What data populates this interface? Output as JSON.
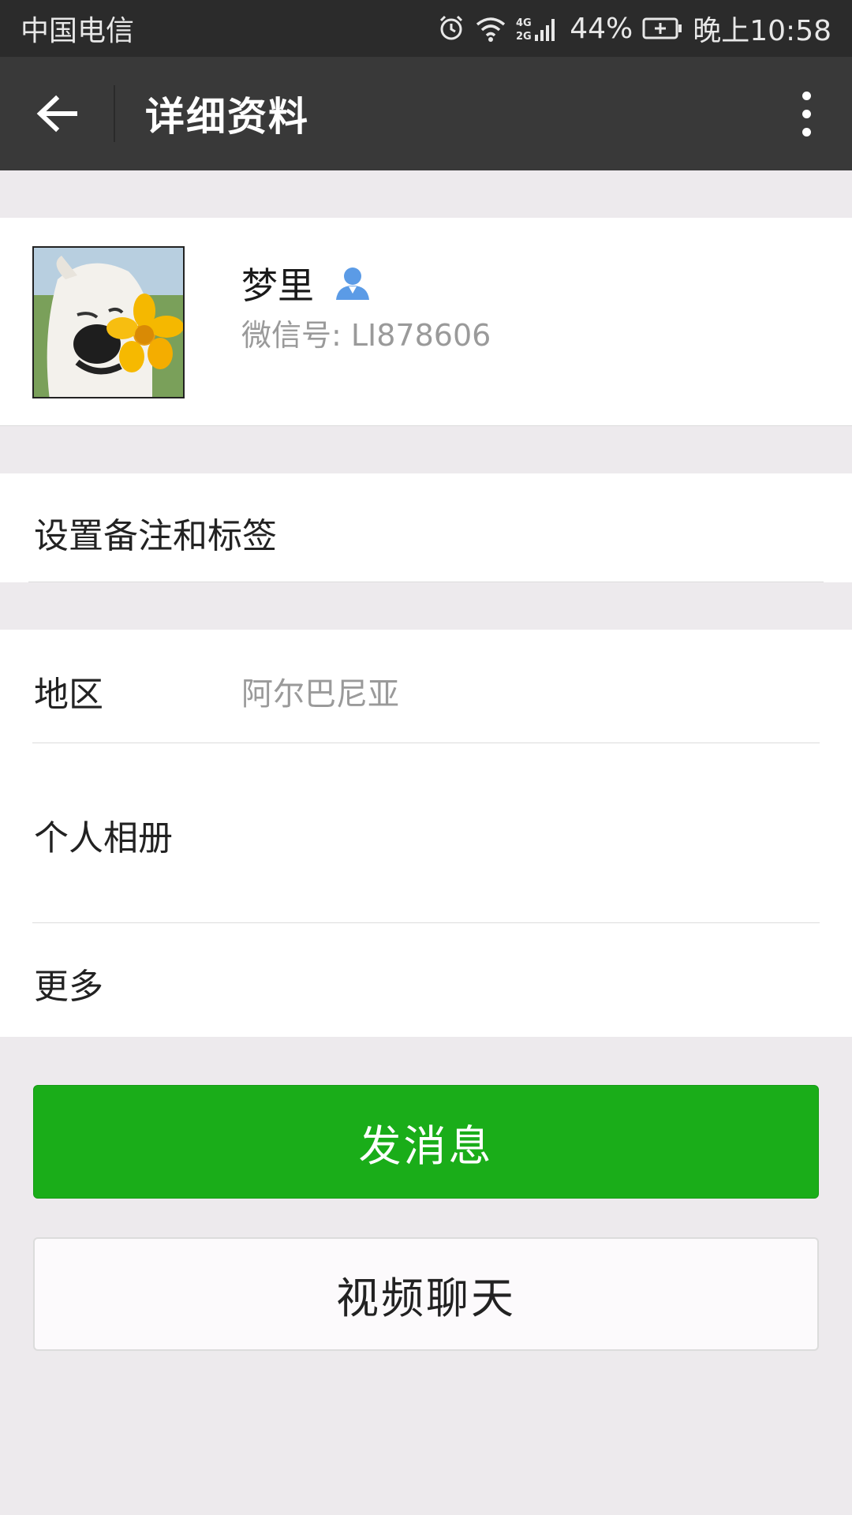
{
  "status_bar": {
    "carrier": "中国电信",
    "network": "4G 2G",
    "battery": "44%",
    "time": "晚上10:58"
  },
  "title_bar": {
    "title": "详细资料",
    "back_icon": "arrow-left-icon",
    "more_icon": "more-vertical-icon"
  },
  "profile": {
    "nickname": "梦里",
    "wechat_id": "微信号: LI878606",
    "avatar_desc_icon": "avatar-image",
    "gender_icon": "person-icon",
    "gender_icon_color": "#5b9be6"
  },
  "remark": {
    "label": "设置备注和标签"
  },
  "info": {
    "region_label": "地区",
    "region_value": "阿尔巴尼亚",
    "album_label": "个人相册",
    "more_label": "更多"
  },
  "actions": {
    "send_message": "发消息",
    "video_chat": "视频聊天",
    "send_message_color": "#1aad19"
  }
}
